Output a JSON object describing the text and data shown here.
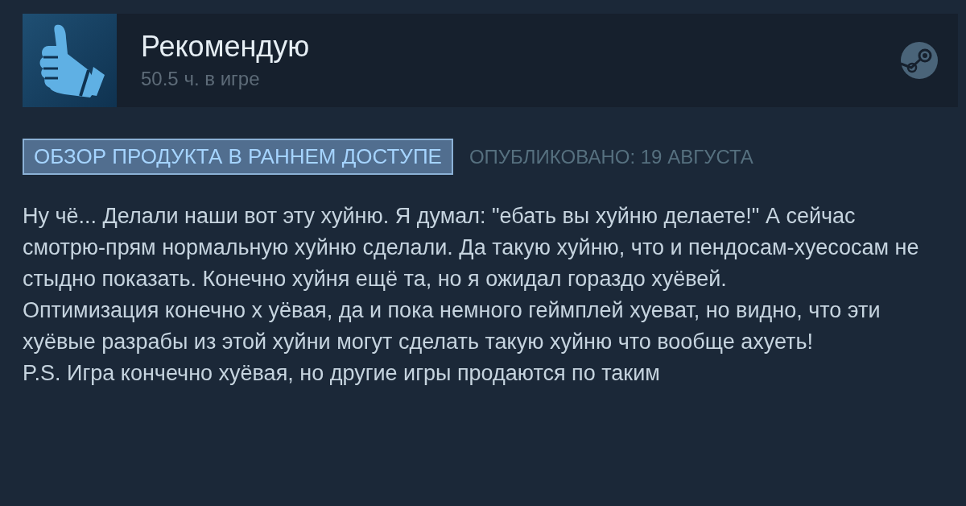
{
  "review": {
    "verdict": "Рекомендую",
    "hours": "50.5 ч. в игре"
  },
  "badge": "ОБЗОР ПРОДУКТА В РАННЕМ ДОСТУПЕ",
  "published": "ОПУБЛИКОВАНО: 19 АВГУСТА",
  "paragraphs": [
    "Ну чё... Делали наши вот эту хуйню. Я думал: \"ебать вы хуйню делаете!\" А сейчас смотрю-прям нормальную хуйню сделали. Да такую хуйню, что и пендосам-хуесосам не стыдно показать. Конечно хуйня ещё та, но я ожидал гораздо хуёвей.",
    "Оптимизация конечно х уёвая, да и пока немного геймплей хуеват, но видно, что эти хуёвые разрабы из этой хуйни могут сделать такую хуйню что вообще ахуеть!",
    "P.S. Игра кончечно хуёвая, но другие игры продаются по таким"
  ]
}
